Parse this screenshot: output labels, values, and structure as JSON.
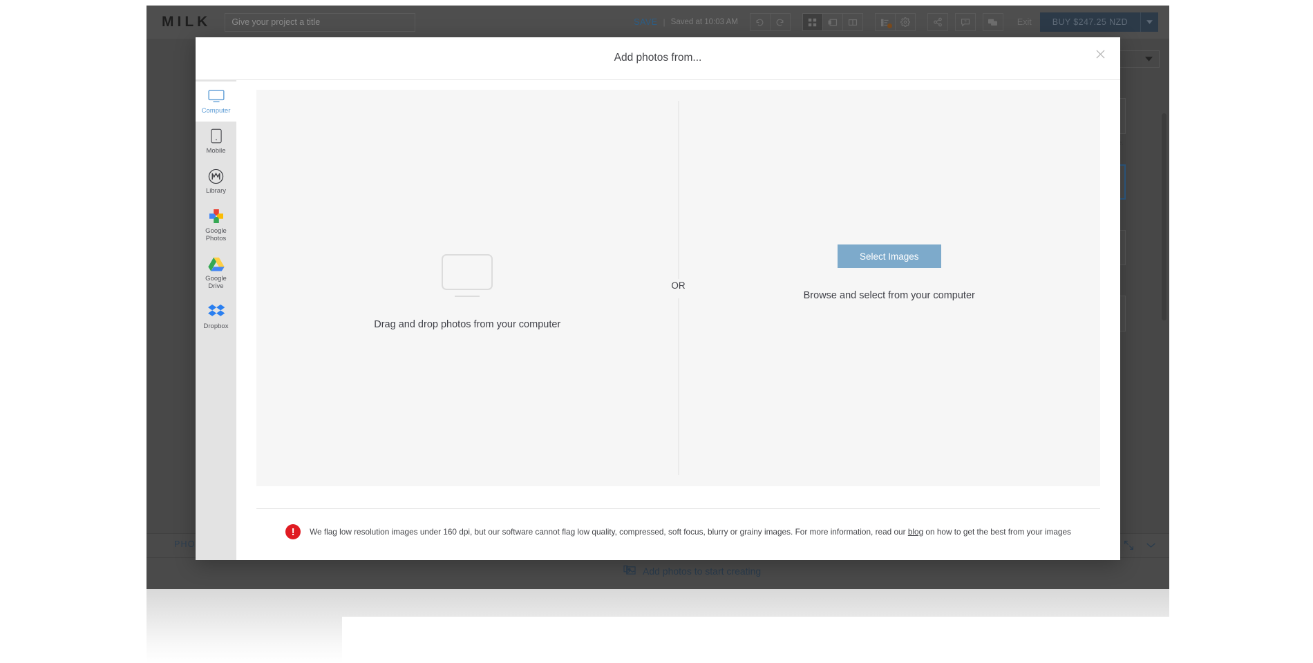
{
  "app": {
    "logo": "MILK",
    "title_placeholder": "Give your project a title",
    "save_label": "SAVE",
    "save_separator": "|",
    "saved_at": "Saved at 10:03 AM",
    "exit_label": "Exit",
    "buy_label": "BUY $247.25 NZD",
    "toolbar_icons": [
      "undo-icon",
      "redo-icon",
      "grid-view-icon",
      "single-page-icon",
      "spread-view-icon",
      "layers-list-icon",
      "settings-gear-icon",
      "share-icon",
      "help-icon",
      "comments-icon"
    ],
    "footer": {
      "photos_tab": "PHOTOS",
      "cta": "Add photos to start creating",
      "cta_icon": "photo-placeholder-icon",
      "tools": [
        "expand-icon",
        "chevron-down-icon"
      ]
    }
  },
  "modal": {
    "title": "Add photos from...",
    "close_icon": "close-icon",
    "sources": [
      {
        "label": "Computer",
        "icon": "monitor-icon",
        "active": true
      },
      {
        "label": "Mobile",
        "icon": "mobile-device-icon",
        "active": false
      },
      {
        "label": "Library",
        "icon": "milk-library-icon",
        "active": false
      },
      {
        "label": "Google\nPhotos",
        "icon": "google-photos-icon",
        "active": false
      },
      {
        "label": "Google\nDrive",
        "icon": "google-drive-icon",
        "active": false
      },
      {
        "label": "Dropbox",
        "icon": "dropbox-icon",
        "active": false
      }
    ],
    "dropzone": {
      "left_icon": "monitor-icon",
      "left_caption": "Drag and drop photos from your computer",
      "divider_label": "OR",
      "select_button": "Select Images",
      "right_caption": "Browse and select from your computer"
    },
    "footer_notice": {
      "icon": "exclamation-icon",
      "text_before": "We flag low resolution images under 160 dpi, but our software cannot flag low quality, compressed, soft focus, blurry or grainy images. For more information, read our ",
      "link": "blog",
      "text_after": " on how to get the best from your images"
    }
  },
  "colors": {
    "accent_blue": "#5b9bd5",
    "button_blue": "#7daacb",
    "save_blue": "#2d5e86",
    "buy_navy": "#2c3a48",
    "warning_red": "#e01b22",
    "modal_bg": "#ffffff",
    "dropzone_bg": "#f6f6f6",
    "sidebar_bg": "#e3e3e3",
    "app_chrome": "#4a4a4a"
  }
}
